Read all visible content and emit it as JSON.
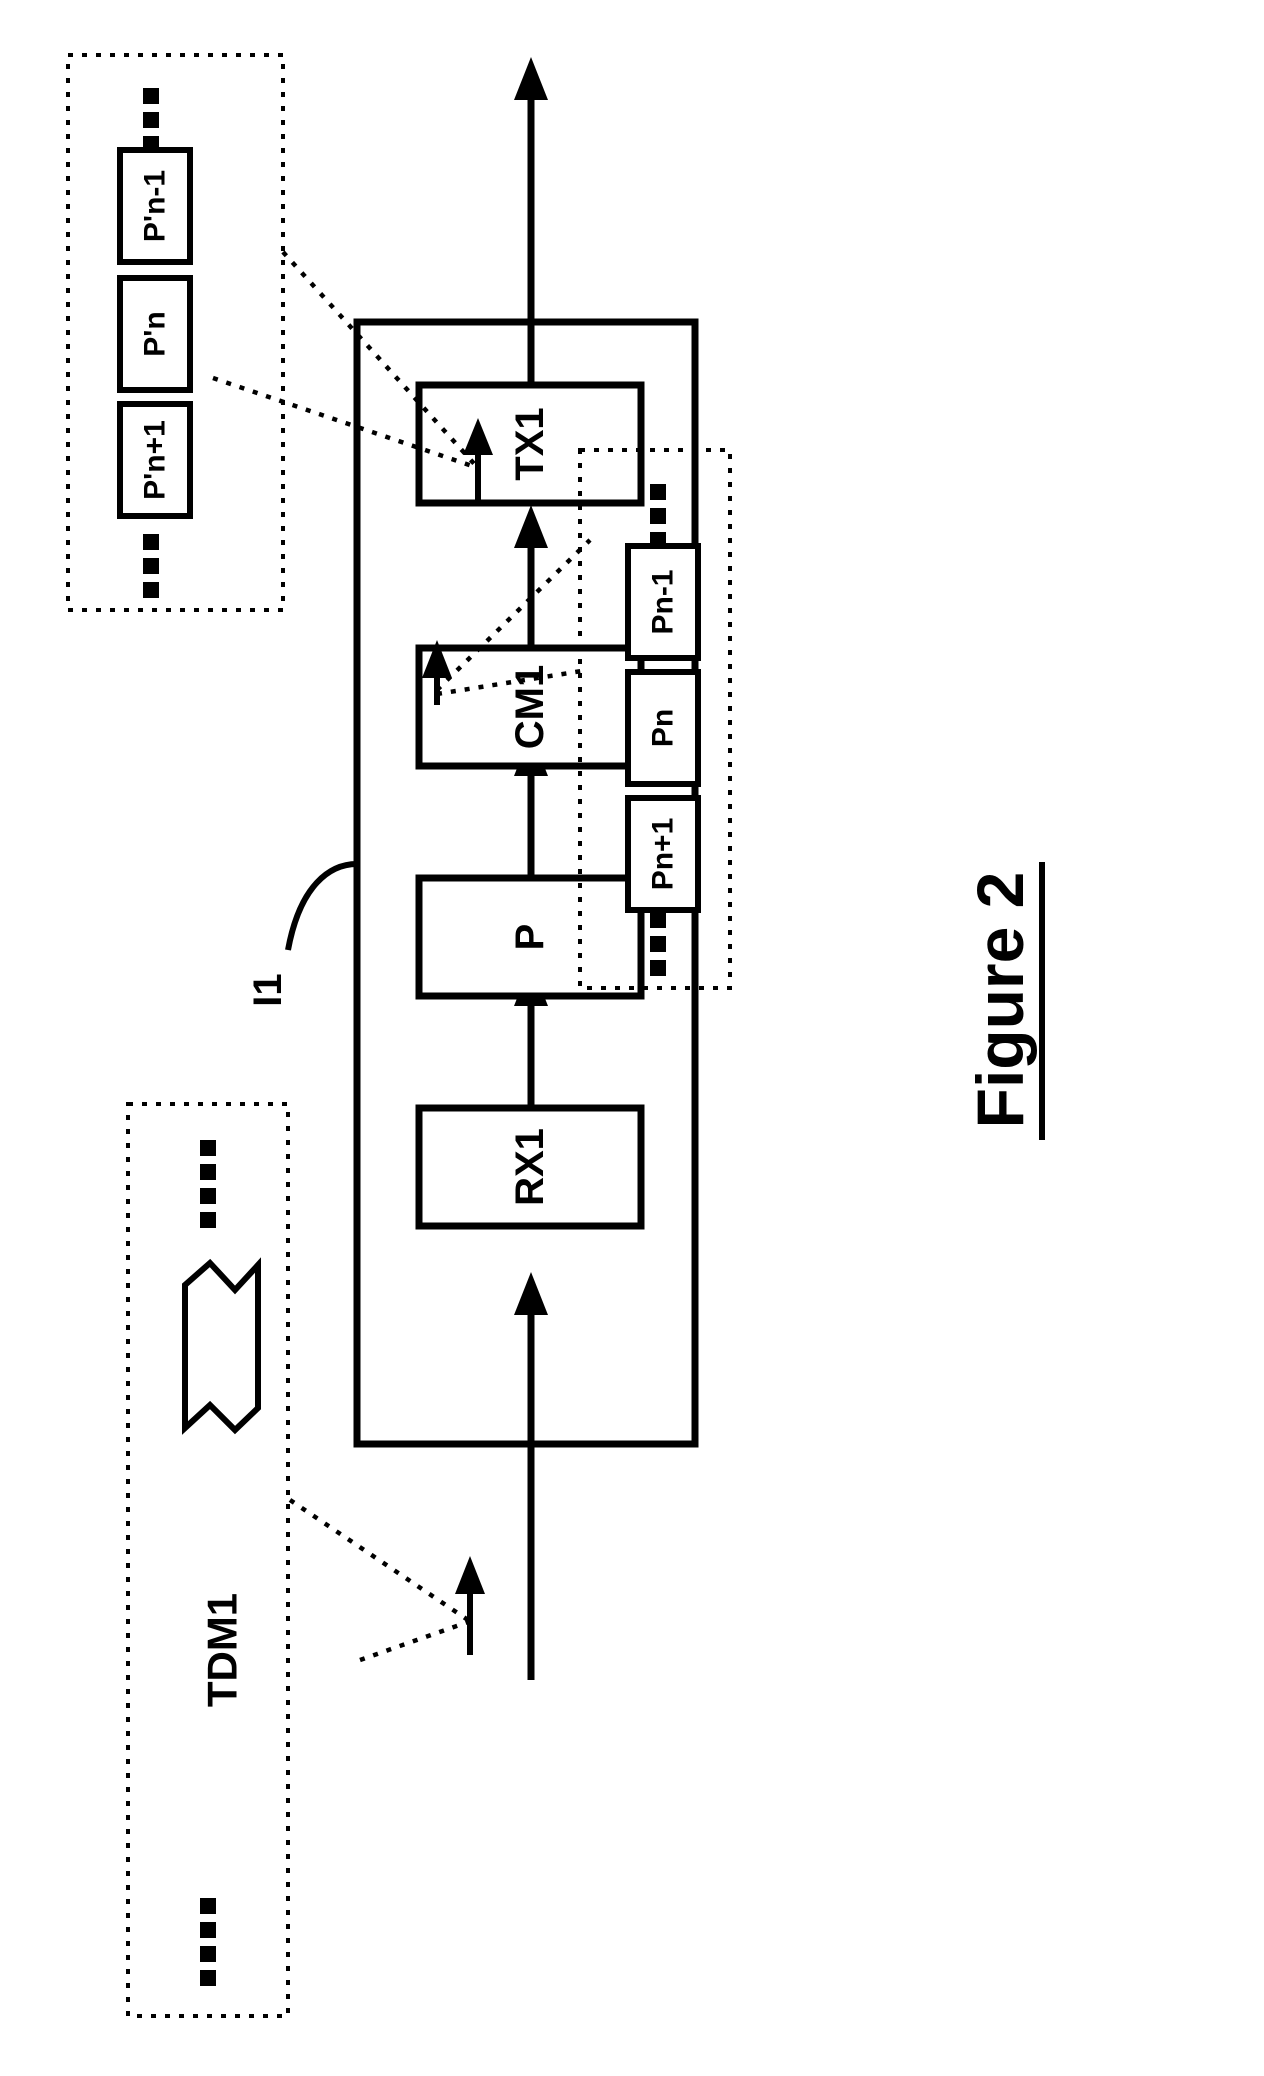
{
  "figure": {
    "title": "Figure 2",
    "title_underlined": true,
    "orientation": "rotated-90-ccw",
    "background_color": "#ffffff",
    "line_color": "#000000"
  },
  "device": {
    "reference_label": "I1",
    "blocks": [
      {
        "id": "rx1",
        "label": "RX1"
      },
      {
        "id": "p",
        "label": "P"
      },
      {
        "id": "cm1",
        "label": "CM1"
      },
      {
        "id": "tx1",
        "label": "TX1"
      }
    ]
  },
  "input_group": {
    "name": "tdm-input-stream",
    "label": "TDM1",
    "leading_ellipsis": "■ ■ ■ ■",
    "trailing_ellipsis": "■ ■ ■ ■"
  },
  "packet_group_in": {
    "name": "input-packets",
    "items": [
      {
        "label": "Pn-1"
      },
      {
        "label": "Pn"
      },
      {
        "label": "Pn+1"
      }
    ],
    "leading_ellipsis": "■ ■ ■ ■",
    "trailing_ellipsis": "■ ■ ■ ■"
  },
  "packet_group_out": {
    "name": "output-packets",
    "items": [
      {
        "label": "P'n-1"
      },
      {
        "label": "P'n"
      },
      {
        "label": "P'n+1"
      }
    ],
    "leading_ellipsis": "■ ■ ■ ■",
    "trailing_ellipsis": "■ ■ ■ ■"
  },
  "signal_flow": {
    "arrows": [
      {
        "name": "tdm-into-rx1"
      },
      {
        "name": "rx1-to-p"
      },
      {
        "name": "p-to-cm1"
      },
      {
        "name": "cm1-to-tx1"
      },
      {
        "name": "tx1-output"
      },
      {
        "name": "packet-marker-input"
      },
      {
        "name": "packet-marker-output"
      }
    ]
  }
}
